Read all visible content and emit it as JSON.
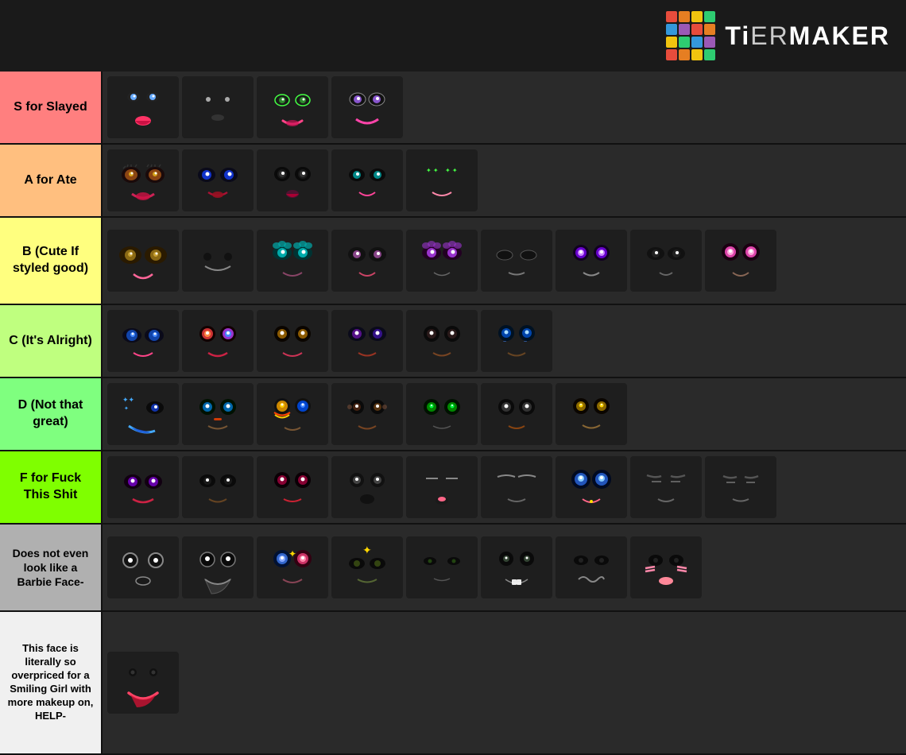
{
  "header": {
    "logo_text": "TiERMAKER",
    "logo_colors": [
      "#e74c3c",
      "#e67e22",
      "#f1c40f",
      "#2ecc71",
      "#3498db",
      "#9b59b6",
      "#e74c3c",
      "#e67e22",
      "#f1c40f",
      "#2ecc71",
      "#3498db",
      "#9b59b6",
      "#e74c3c",
      "#e67e22",
      "#f1c40f",
      "#2ecc71"
    ]
  },
  "tiers": [
    {
      "id": "s",
      "label": "S for Slayed",
      "color": "#ff7f7f",
      "face_count": 4
    },
    {
      "id": "a",
      "label": "A for Ate",
      "color": "#ffbf7f",
      "face_count": 5
    },
    {
      "id": "b",
      "label": "B (Cute If styled good)",
      "color": "#ffff7f",
      "face_count": 9
    },
    {
      "id": "c",
      "label": "C (It's Alright)",
      "color": "#bfff7f",
      "face_count": 6
    },
    {
      "id": "d",
      "label": "D (Not that great)",
      "color": "#7fff7f",
      "face_count": 7
    },
    {
      "id": "f",
      "label": "F for Fuck This Shit",
      "color": "#7fff00",
      "face_count": 9
    },
    {
      "id": "dne",
      "label": "Does not even look like a Barbie Face-",
      "color": "#b0b0b0",
      "face_count": 8
    },
    {
      "id": "bot",
      "label": "This face is literally so overpriced for a Smiling Girl with more makeup on, HELP-",
      "color": "#f0f0f0",
      "face_count": 1
    }
  ]
}
